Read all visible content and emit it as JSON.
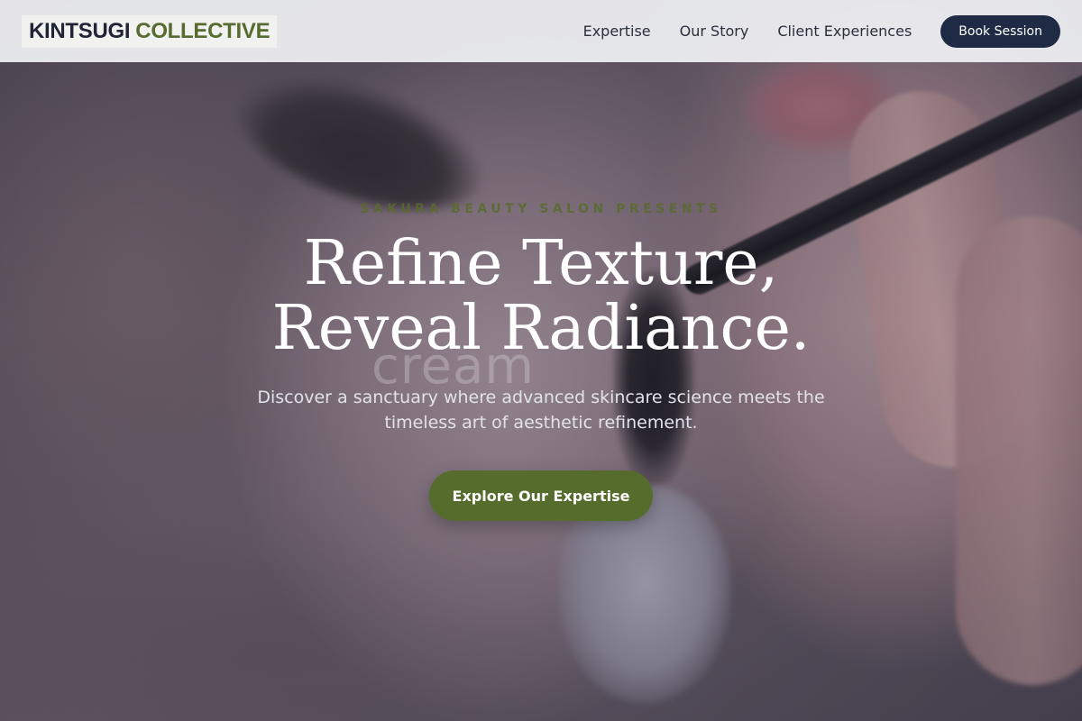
{
  "brand": {
    "name_part1": "KINTSUGI",
    "name_part2": "COLLECTIVE"
  },
  "nav": {
    "links": [
      "Expertise",
      "Our Story",
      "Client Experiences"
    ],
    "cta_label": "Book Session"
  },
  "hero": {
    "kicker": "SAKURA BEAUTY SALON PRESENTS",
    "headline_line1": "Refine Texture,",
    "headline_line2": "Reveal Radiance.",
    "subtext": "Discover a sanctuary where advanced skincare science meets the timeless art of aesthetic refinement.",
    "cta_label": "Explore Our Expertise",
    "background_watermark": "cream"
  },
  "colors": {
    "accent_green": "#566c2d",
    "navy": "#1f2a44",
    "nav_background": "#f0f1f4"
  }
}
